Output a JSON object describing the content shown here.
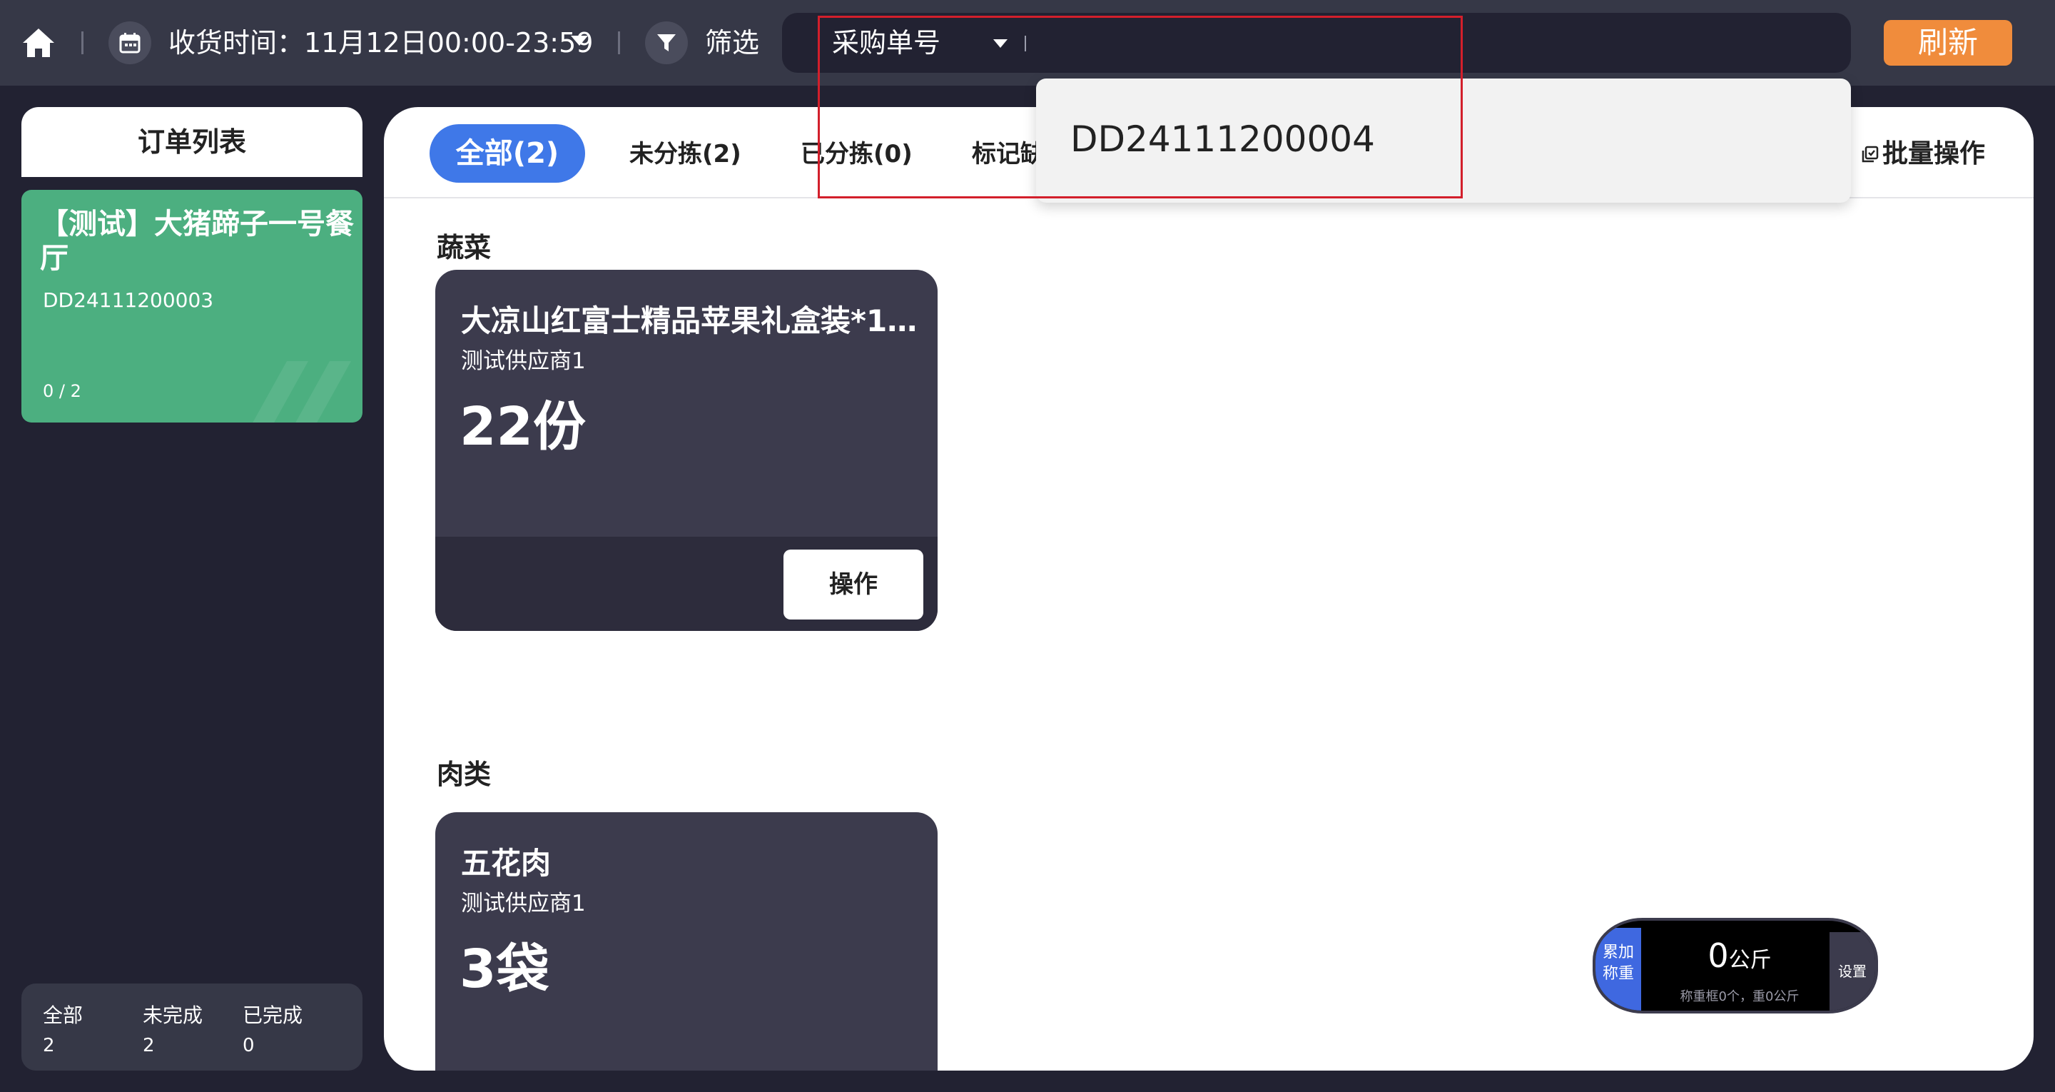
{
  "topbar": {
    "time_label": "收货时间：11月12日00:00-23:59",
    "filter_label": "筛选",
    "search_type": "采购单号",
    "search_value": "",
    "refresh_label": "刷新"
  },
  "left_panel": {
    "title": "订单列表",
    "order": {
      "name": "【测试】大猪蹄子一号餐厅",
      "number": "DD24111200003",
      "progress": "0 / 2"
    },
    "stats": [
      {
        "label": "全部",
        "value": "2"
      },
      {
        "label": "未完成",
        "value": "2"
      },
      {
        "label": "已完成",
        "value": "0"
      }
    ]
  },
  "tabs": [
    {
      "label": "全部(2)",
      "active": true
    },
    {
      "label": "未分拣(2)"
    },
    {
      "label": "已分拣(0)"
    },
    {
      "label": "标记缺"
    }
  ],
  "batch_label": "批量操作",
  "categories": [
    {
      "name": "蔬菜",
      "goods": [
        {
          "title": "大凉山红富士精品苹果礼盒装*1...",
          "supplier": "测试供应商1",
          "quantity": "22份",
          "action": "操作"
        }
      ]
    },
    {
      "name": "肉类",
      "goods": [
        {
          "title": "五花肉",
          "supplier": "测试供应商1",
          "quantity": "3袋"
        }
      ]
    }
  ],
  "dropdown": {
    "options": [
      "DD24111200004"
    ]
  },
  "scale": {
    "accumulate_label": "累加称重",
    "value": "0",
    "unit": "公斤",
    "sub": "称重框0个，重0公斤",
    "settings_label": "设置"
  },
  "colors": {
    "background": "#222232",
    "topbar": "#363847",
    "accent_blue": "#3f78e8",
    "order_green": "#4caf80",
    "refresh_orange": "#f08c3c",
    "card_dark": "#3c3b4d",
    "highlight_red": "#d31f2b"
  }
}
